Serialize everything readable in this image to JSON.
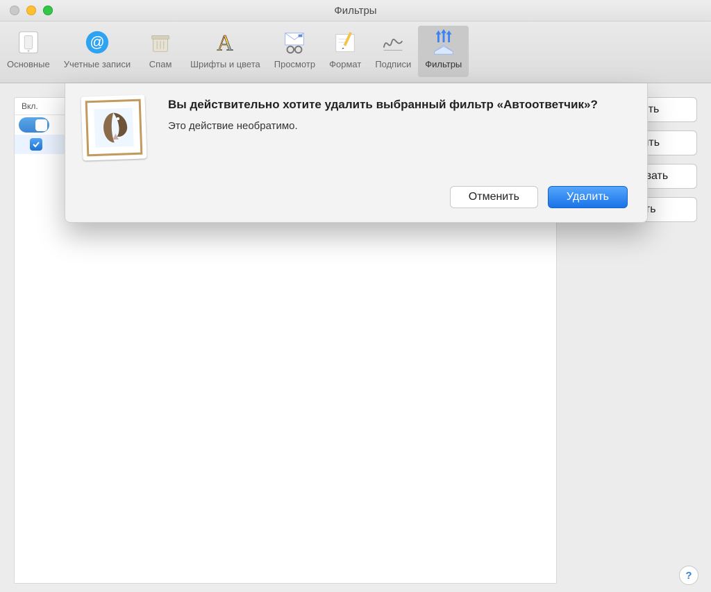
{
  "window": {
    "title": "Фильтры"
  },
  "toolbar": {
    "items": [
      {
        "label": "Основные"
      },
      {
        "label": "Учетные записи"
      },
      {
        "label": "Спам"
      },
      {
        "label": "Шрифты и цвета"
      },
      {
        "label": "Просмотр"
      },
      {
        "label": "Формат"
      },
      {
        "label": "Подписи"
      },
      {
        "label": "Фильтры"
      }
    ]
  },
  "list": {
    "col_enabled": "Вкл."
  },
  "side_buttons": {
    "btn1": "Добавить",
    "btn2": "Изменить",
    "btn3": "Дублировать",
    "btn4": "Удалить"
  },
  "dialog": {
    "title": "Вы действительно хотите удалить выбранный фильтр «Автоответчик»?",
    "message": "Это действие необратимо.",
    "cancel": "Отменить",
    "confirm": "Удалить"
  },
  "help_glyph": "?"
}
